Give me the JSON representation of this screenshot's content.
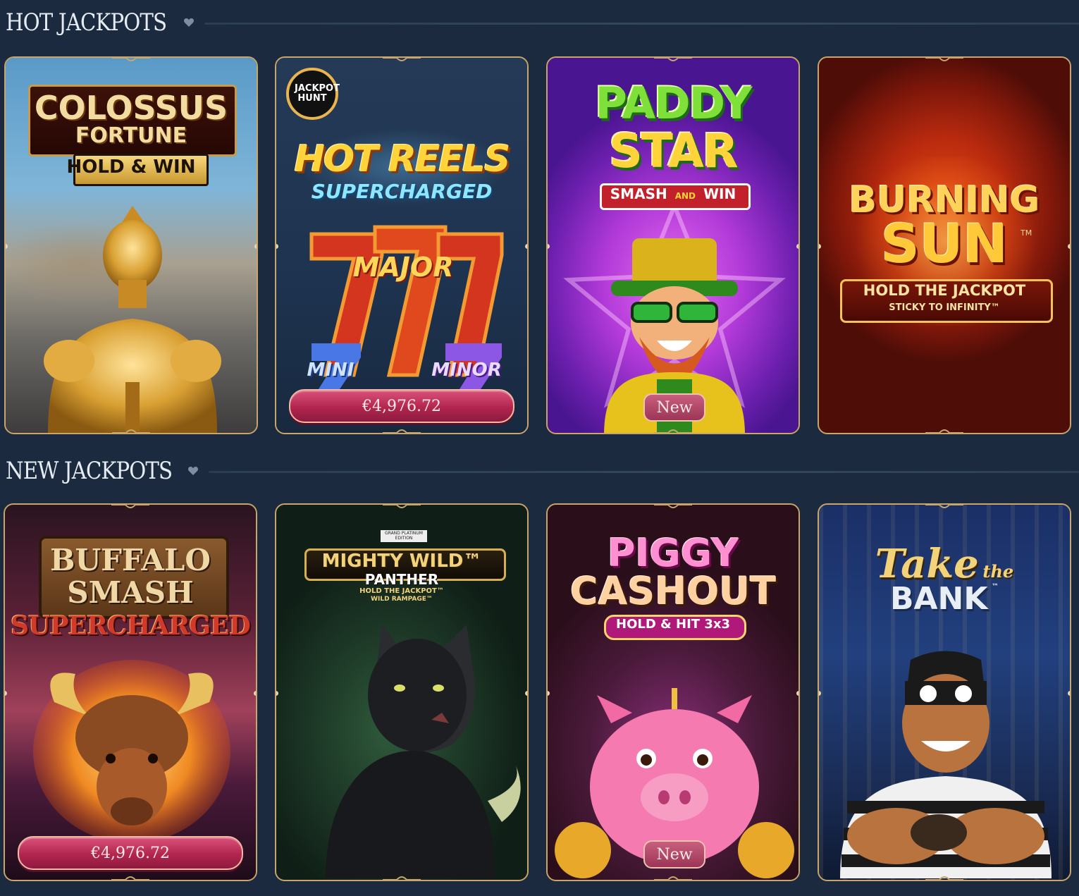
{
  "sections": [
    {
      "title": "HOT JACKPOTS",
      "games": [
        {
          "logo_line1": "COLOSSUS",
          "logo_line2": "FORTUNE",
          "logo_line3": "HOLD & WIN",
          "jackpot": "",
          "badge": ""
        },
        {
          "corner_badge": "JACKPOT HUNT",
          "logo_line1": "HOT REELS",
          "logo_line2": "SUPERCHARGED",
          "reel_major": "MAJOR",
          "reel_mini": "MINI",
          "reel_minor": "MINOR",
          "jackpot": "€4,976.72",
          "badge": ""
        },
        {
          "logo_line1": "PADDY",
          "logo_line2": "STAR",
          "logo_line3": "SMASH",
          "logo_line4": "AND",
          "logo_line5": "WIN",
          "jackpot": "",
          "badge": "New"
        },
        {
          "logo_line1": "BURNING",
          "logo_line2": "SUN",
          "logo_tm": "TM",
          "logo_line3": "HOLD THE JACKPOT",
          "logo_line4": "STICKY TO INFINITY™",
          "jackpot": "",
          "badge": ""
        }
      ]
    },
    {
      "title": "NEW JACKPOTS",
      "games": [
        {
          "logo_line1": "BUFFALO",
          "logo_line2": "SMASH",
          "logo_line3": "SUPERCHARGED",
          "jackpot": "€4,976.72",
          "badge": ""
        },
        {
          "logo_line0": "GRAND PLATINUM EDITION",
          "logo_line1": "MIGHTY WILD™",
          "logo_line2": "PANTHER",
          "logo_line3": "HOLD THE JACKPOT™",
          "logo_line4": "WILD RAMPAGE™",
          "jackpot": "",
          "badge": ""
        },
        {
          "logo_line1": "PIGGY",
          "logo_line2": "CASHOUT",
          "logo_line3": "HOLD & HIT 3x3",
          "jackpot": "",
          "badge": "New"
        },
        {
          "logo_line1": "Take",
          "logo_line2": "the",
          "logo_line3": "BANK",
          "logo_tm": "™",
          "jackpot": "",
          "badge": ""
        }
      ]
    }
  ],
  "colors": {
    "page_bg": "#1b2a3e",
    "card_border": "#c8a56a",
    "pill_pink": "#b2254f",
    "title_text": "#e6ecf3"
  },
  "icons": {
    "favorite": "heart-icon",
    "card_ornament": "ornament-icon"
  }
}
